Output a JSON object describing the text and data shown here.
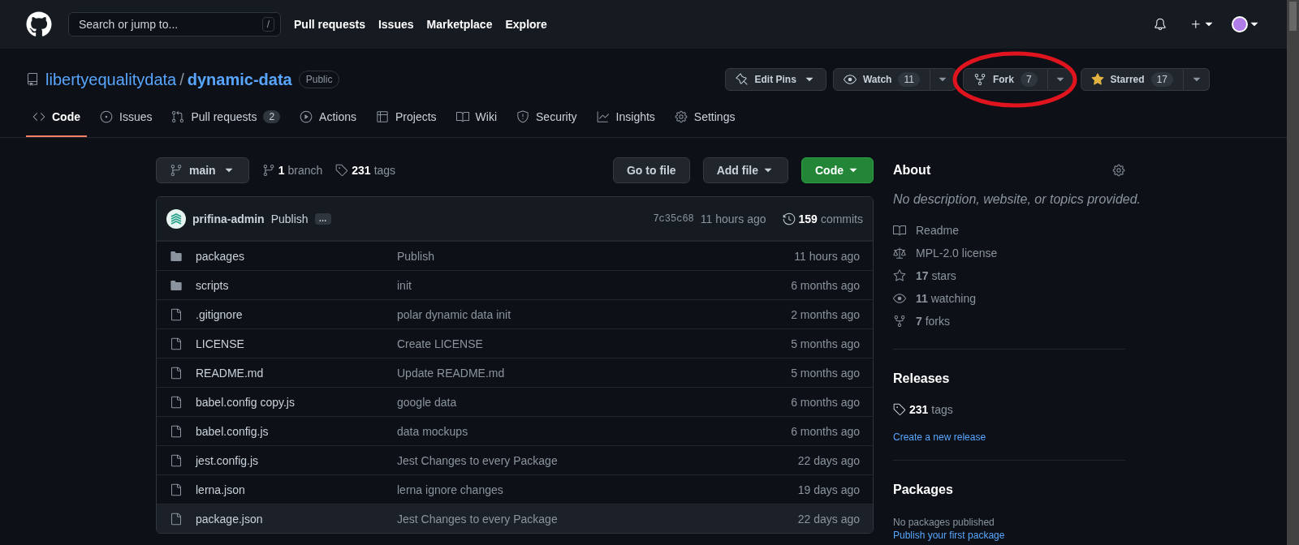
{
  "header": {
    "search_placeholder": "Search or jump to...",
    "search_key": "/",
    "nav": [
      "Pull requests",
      "Issues",
      "Marketplace",
      "Explore"
    ]
  },
  "repo": {
    "owner": "libertyequalitydata",
    "separator": "/",
    "name": "dynamic-data",
    "visibility": "Public",
    "actions": [
      {
        "kind": "pin",
        "label": "Edit Pins",
        "highlighted": false
      },
      {
        "kind": "watch",
        "label": "Watch",
        "count": "11",
        "highlighted": false
      },
      {
        "kind": "fork",
        "label": "Fork",
        "count": "7",
        "highlighted": true
      },
      {
        "kind": "star",
        "label": "Starred",
        "count": "17",
        "highlighted": false
      }
    ]
  },
  "tabs": [
    {
      "label": "Code",
      "selected": true
    },
    {
      "label": "Issues",
      "selected": false
    },
    {
      "label": "Pull requests",
      "count": "2",
      "selected": false
    },
    {
      "label": "Actions",
      "selected": false
    },
    {
      "label": "Projects",
      "selected": false
    },
    {
      "label": "Wiki",
      "selected": false
    },
    {
      "label": "Security",
      "selected": false
    },
    {
      "label": "Insights",
      "selected": false
    },
    {
      "label": "Settings",
      "selected": false
    }
  ],
  "toolbar": {
    "branch": "main",
    "branches_count": "1",
    "branches_label": "branch",
    "tags_count": "231",
    "tags_label": "tags",
    "buttons": [
      "Go to file",
      "Add file",
      "Code"
    ]
  },
  "commit": {
    "author": "prifina-admin",
    "message": "Publish",
    "more": "…",
    "sha": "7c35c68",
    "time": "11 hours ago",
    "commits_count": "159",
    "commits_label": "commits"
  },
  "files": [
    {
      "kind": "folder",
      "name": "packages",
      "message": "Publish",
      "time": "11 hours ago",
      "hovered": false
    },
    {
      "kind": "folder",
      "name": "scripts",
      "message": "init",
      "time": "6 months ago",
      "hovered": false
    },
    {
      "kind": "file",
      "name": ".gitignore",
      "message": "polar dynamic data init",
      "time": "2 months ago",
      "hovered": false
    },
    {
      "kind": "file",
      "name": "LICENSE",
      "message": "Create LICENSE",
      "time": "5 months ago",
      "hovered": false
    },
    {
      "kind": "file",
      "name": "README.md",
      "message": "Update README.md",
      "time": "5 months ago",
      "hovered": false
    },
    {
      "kind": "file",
      "name": "babel.config copy.js",
      "message": "google data",
      "time": "6 months ago",
      "hovered": false
    },
    {
      "kind": "file",
      "name": "babel.config.js",
      "message": "data mockups",
      "time": "6 months ago",
      "hovered": false
    },
    {
      "kind": "file",
      "name": "jest.config.js",
      "message": "Jest Changes to every Package",
      "time": "22 days ago",
      "hovered": false
    },
    {
      "kind": "file",
      "name": "lerna.json",
      "message": "lerna ignore changes",
      "time": "19 days ago",
      "hovered": false
    },
    {
      "kind": "file",
      "name": "package.json",
      "message": "Jest Changes to every Package",
      "time": "22 days ago",
      "hovered": true
    }
  ],
  "about": {
    "title": "About",
    "description": "No description, website, or topics provided.",
    "items": [
      {
        "kind": "readme",
        "label": "Readme"
      },
      {
        "kind": "license",
        "label": "MPL-2.0 license"
      },
      {
        "kind": "stars",
        "count": "17",
        "label": "stars"
      },
      {
        "kind": "watching",
        "count": "11",
        "label": "watching"
      },
      {
        "kind": "forks",
        "count": "7",
        "label": "forks"
      }
    ]
  },
  "releases": {
    "title": "Releases",
    "tags_count": "231",
    "tags_label": "tags",
    "link": "Create a new release"
  },
  "packages": {
    "title": "Packages",
    "text": "No packages published",
    "link": "Publish your first package"
  }
}
